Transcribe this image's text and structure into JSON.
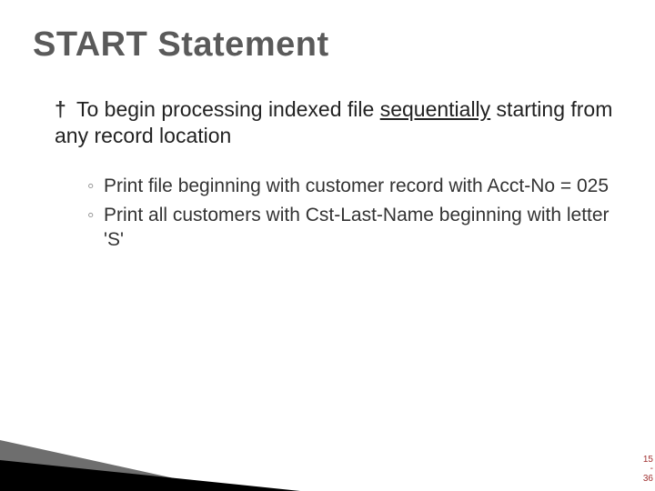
{
  "title": "START Statement",
  "main": {
    "marker": "†",
    "pre": "To begin processing indexed file ",
    "underlined": "sequentially",
    "post": " starting from any record location"
  },
  "subs": [
    {
      "marker": "◦",
      "text": "Print file beginning with customer record with Acct-No = 025"
    },
    {
      "marker": "◦",
      "text": "Print all customers with Cst-Last-Name beginning with letter 'S'"
    }
  ],
  "pagenum": {
    "top": "15",
    "mid": "-",
    "bot": "36"
  }
}
